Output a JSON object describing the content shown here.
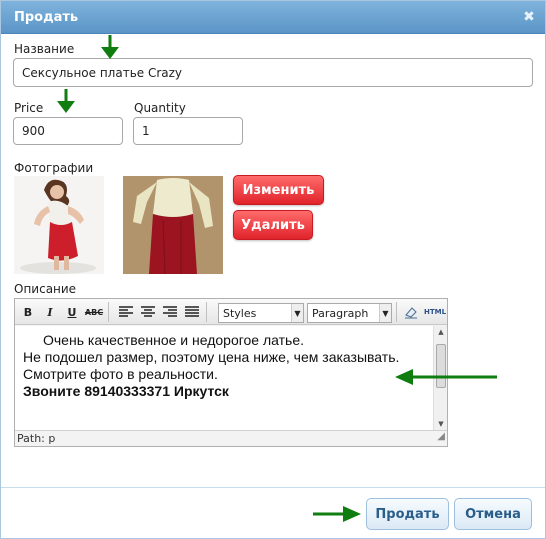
{
  "dialog": {
    "title": "Продать",
    "close_glyph": "✖"
  },
  "form": {
    "name_label": "Название",
    "name_value": "Сексульное платье Crazy",
    "price_label": "Price",
    "price_value": "900",
    "quantity_label": "Quantity",
    "quantity_value": "1",
    "photos_label": "Фотографии",
    "change_button": "Изменить",
    "delete_button": "Удалить",
    "description_label": "Описание"
  },
  "editor": {
    "toolbar": {
      "bold": "B",
      "italic": "I",
      "underline": "U",
      "strike": "ABC",
      "styles_select": "Styles",
      "format_select": "Paragraph",
      "html_button": "HTML"
    },
    "content": {
      "line1": "Очень качественное и недорогое латье.",
      "line2": "Не подошел размер, поэтому цена ниже, чем заказывать.",
      "line3": "Смотрите фото в реальности.",
      "line4": "Звоните 89140333371 Иркутск"
    },
    "path": "Path: p"
  },
  "footer": {
    "sell_button": "Продать",
    "cancel_button": "Отмена"
  },
  "colors": {
    "arrow": "#0f7d0f",
    "accent_red": "#e0232b",
    "title_blue": "#5b95c7"
  }
}
